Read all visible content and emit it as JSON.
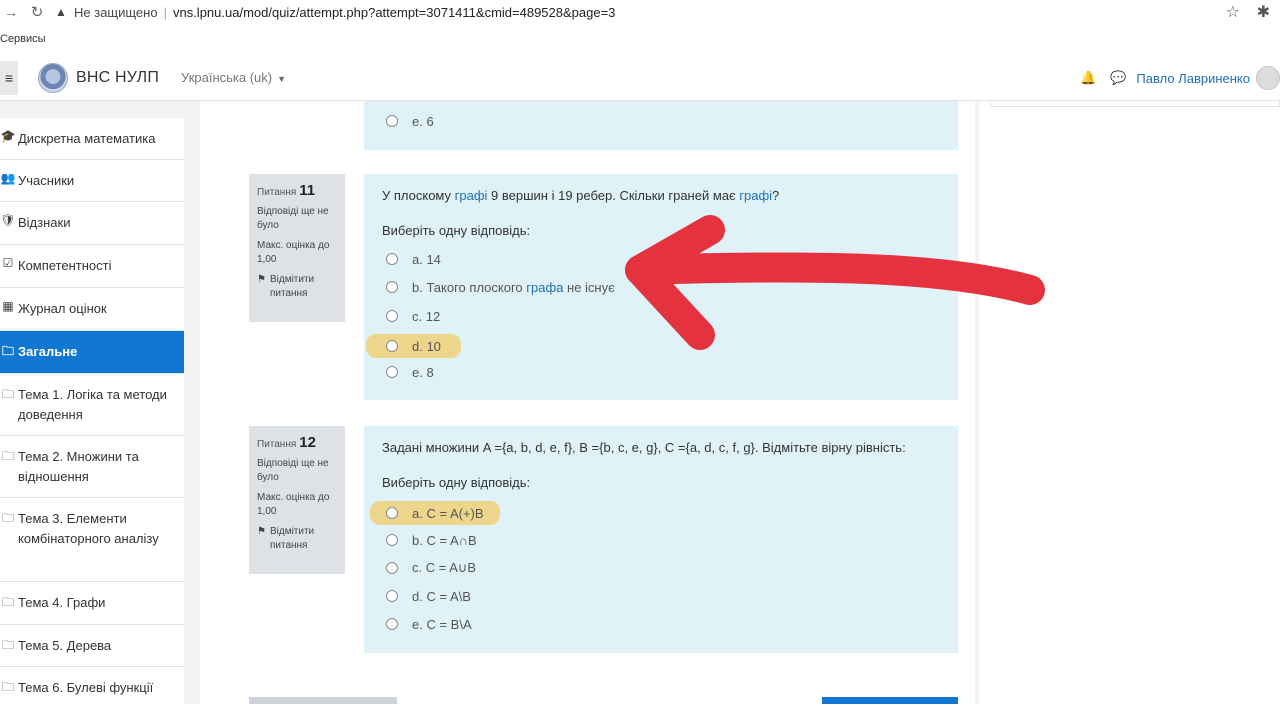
{
  "browser": {
    "back_icon": "arrow-right-icon",
    "reload_icon": "reload-icon",
    "security_label": "Не защищено",
    "url": "vns.lpnu.ua/mod/quiz/attempt.php?attempt=3071411&cmid=489528&page=3",
    "bookmarks_label": "Сервисы"
  },
  "header": {
    "site_name": "ВНС НУЛП",
    "language": "Українська (uk)",
    "user_name": "Павло Лавриненко"
  },
  "drawer": {
    "items": [
      {
        "icon": "graduation-cap-icon",
        "glyph": "🎓",
        "label": "Дискретна математика"
      },
      {
        "icon": "users-icon",
        "glyph": "👥",
        "label": "Учасники"
      },
      {
        "icon": "shield-icon",
        "glyph": "🛡",
        "label": "Відзнаки"
      },
      {
        "icon": "checkbox-icon",
        "glyph": "☑",
        "label": "Компетентності"
      },
      {
        "icon": "table-icon",
        "glyph": "▦",
        "label": "Журнал оцінок"
      },
      {
        "icon": "folder-icon",
        "glyph": "🗀",
        "label": "Загальне",
        "active": true
      },
      {
        "icon": "folder-icon",
        "glyph": "🗀",
        "label": "Тема 1. Логіка та методи доведення"
      },
      {
        "icon": "folder-icon",
        "glyph": "🗀",
        "label": "Тема 2. Множини та відношення"
      },
      {
        "icon": "folder-icon",
        "glyph": "🗀",
        "label": "Тема 3. Елементи комбінаторного аналізу"
      },
      {
        "icon": "folder-icon",
        "glyph": "🗀",
        "label": "Тема 4. Графи"
      },
      {
        "icon": "folder-icon",
        "glyph": "🗀",
        "label": "Тема 5. Дерева"
      },
      {
        "icon": "folder-icon",
        "glyph": "🗀",
        "label": "Тема 6. Булеві функції"
      }
    ]
  },
  "prev_question": {
    "last_option": "e. 6"
  },
  "questions": [
    {
      "label": "Питання",
      "number": "11",
      "state": "Відповіді ще не було",
      "grade": "Макс. оцінка до 1,00",
      "flag": "Відмітити питання",
      "text_parts": [
        "У плоскому ",
        "графі",
        " 9 вершин і 19 ребер. Скільки граней має ",
        "графі",
        "?"
      ],
      "prompt": "Виберіть одну відповідь:",
      "options": [
        "a. 14",
        "b. Такого плоского графа не існує",
        "c. 12",
        "d. 10",
        "e. 8"
      ],
      "highlighted_option": "d. 10"
    },
    {
      "label": "Питання",
      "number": "12",
      "state": "Відповіді ще не було",
      "grade": "Макс. оцінка до 1,00",
      "flag": "Відмітити питання",
      "text": "Задані множини A ={a, b, d, e, f}, B ={b, c, e, g}, C ={a, d, c, f, g}. Відмітьте вірну рівність:",
      "prompt": "Виберіть одну відповідь:",
      "options": [
        "a. C = A(+)B",
        "b. C = A∩B",
        "c. C = A∪B",
        "d. C = A\\B",
        "e. C = B\\A"
      ],
      "highlighted_option": "a. C = A(+)B"
    }
  ],
  "annotation": {
    "icon": "red-arrow",
    "color": "#e5323f"
  }
}
